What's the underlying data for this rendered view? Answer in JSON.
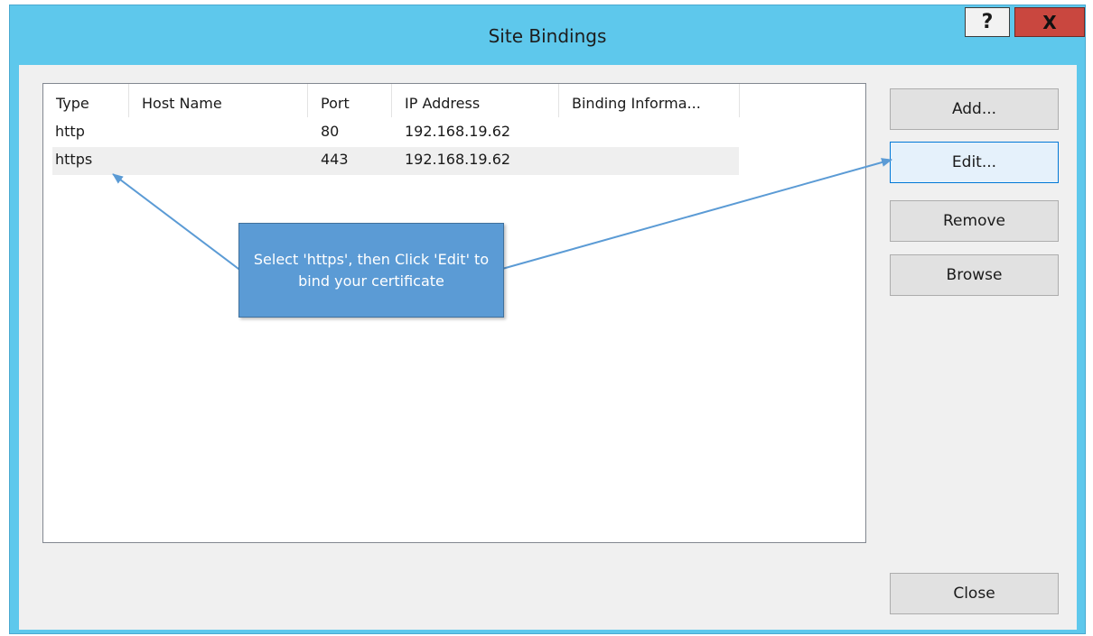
{
  "window": {
    "title": "Site Bindings",
    "help_label": "?",
    "close_label": "X"
  },
  "table": {
    "columns": [
      "Type",
      "Host Name",
      "Port",
      "IP Address",
      "Binding Informa..."
    ],
    "rows": [
      {
        "type": "http",
        "host": "",
        "port": "80",
        "ip": "192.168.19.62",
        "info": ""
      },
      {
        "type": "https",
        "host": "",
        "port": "443",
        "ip": "192.168.19.62",
        "info": ""
      }
    ]
  },
  "buttons": {
    "add": "Add...",
    "edit": "Edit...",
    "remove": "Remove",
    "browse": "Browse",
    "close": "Close"
  },
  "annotation": {
    "text": "Select 'https', then Click 'Edit' to bind your certificate"
  },
  "colors": {
    "titlebar": "#5ec8ec",
    "close_button": "#c9473f",
    "callout": "#5b9bd5",
    "arrow": "#5b9bd5"
  }
}
